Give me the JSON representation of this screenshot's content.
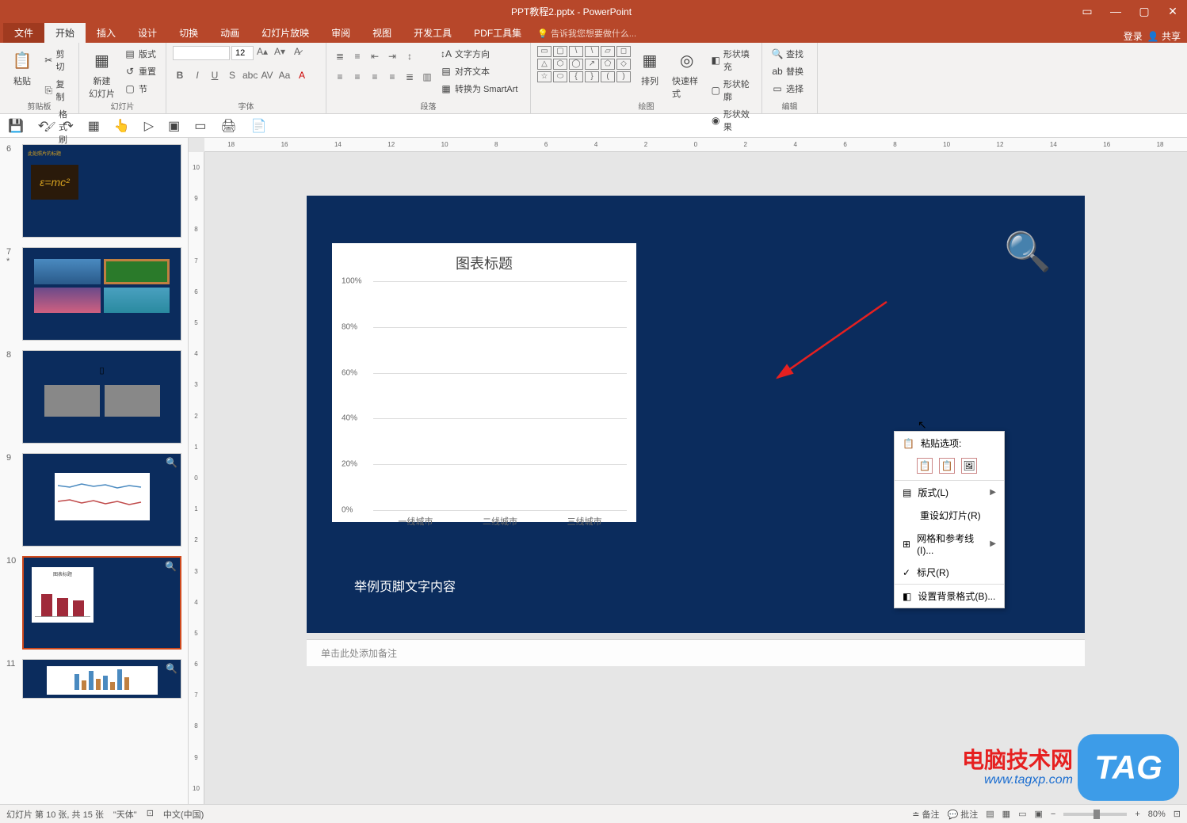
{
  "titlebar": {
    "title": "PPT教程2.pptx - PowerPoint"
  },
  "ribbon_right": {
    "login": "登录",
    "share": "共享"
  },
  "tabs": {
    "file": "文件",
    "items": [
      "开始",
      "插入",
      "设计",
      "切换",
      "动画",
      "幻灯片放映",
      "审阅",
      "视图",
      "开发工具",
      "PDF工具集"
    ],
    "tell_me": "告诉我您想要做什么..."
  },
  "ribbon": {
    "clipboard": {
      "label": "剪贴板",
      "paste": "粘贴",
      "cut": "剪切",
      "copy": "复制",
      "painter": "格式刷"
    },
    "slides": {
      "label": "幻灯片",
      "new": "新建\n幻灯片",
      "layout": "版式",
      "reset": "重置",
      "section": "节"
    },
    "font": {
      "label": "字体",
      "name": "",
      "size": "12"
    },
    "paragraph": {
      "label": "段落",
      "text_dir": "文字方向",
      "align": "对齐文本",
      "smartart": "转换为 SmartArt"
    },
    "drawing": {
      "label": "绘图",
      "arrange": "排列",
      "quick": "快速样式",
      "fill": "形状填充",
      "outline": "形状轮廓",
      "effects": "形状效果"
    },
    "editing": {
      "label": "编辑",
      "find": "查找",
      "replace": "替换",
      "select": "选择"
    }
  },
  "slide": {
    "footer": "举例页脚文字内容",
    "chart": {
      "title": "图表标题"
    }
  },
  "chart_data": {
    "type": "bar",
    "categories": [
      "一线城市",
      "二线城市",
      "三线城市"
    ],
    "values": [
      57,
      47,
      40
    ],
    "title": "图表标题",
    "xlabel": "",
    "ylabel": "",
    "ylim": [
      0,
      100
    ],
    "ytick_format": "%",
    "yticks": [
      0,
      20,
      40,
      60,
      80,
      100
    ]
  },
  "context_menu": {
    "paste_options": "粘贴选项:",
    "layout": "版式(L)",
    "reset": "重设幻灯片(R)",
    "grid": "网格和参考线(I)...",
    "ruler": "标尺(R)",
    "bg": "设置背景格式(B)..."
  },
  "notes": {
    "placeholder": "单击此处添加备注"
  },
  "status": {
    "slide_of": "幻灯片 第 10 张, 共 15 张",
    "theme": "\"天体\"",
    "lang": "中文(中国)",
    "notes": "备注",
    "comments": "批注",
    "zoom": "80%"
  },
  "thumbnails": {
    "numbers": [
      "6",
      "7",
      "8",
      "9",
      "10",
      "11"
    ],
    "star": "*"
  },
  "watermark": {
    "main": "电脑技术网",
    "sub": "www.tagxp.com",
    "tag": "TAG"
  }
}
